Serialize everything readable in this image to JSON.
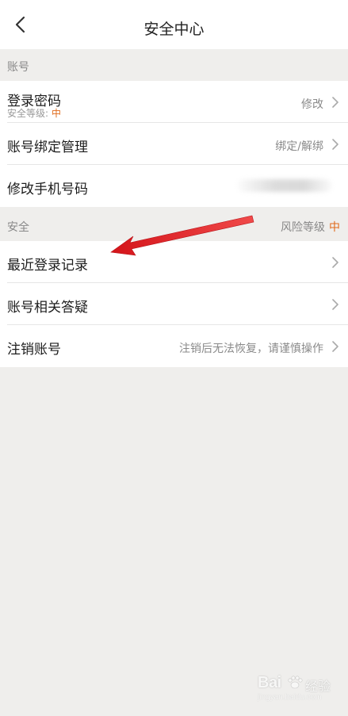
{
  "nav": {
    "title": "安全中心",
    "back_icon": "chevron-left-icon"
  },
  "sections": {
    "account": {
      "header": "账号",
      "rows": [
        {
          "label": "登录密码",
          "sublabel": "安全等级:",
          "sublevel": "中",
          "value": "修改"
        },
        {
          "label": "账号绑定管理",
          "value": "绑定/解绑"
        },
        {
          "label": "修改手机号码",
          "value_blurred": true
        }
      ]
    },
    "security": {
      "header": "安全",
      "risk_label": "风险等级",
      "risk_level": "中",
      "rows": [
        {
          "label": "最近登录记录",
          "value": ""
        },
        {
          "label": "账号相关答疑",
          "value": ""
        },
        {
          "label": "注销账号",
          "value": "注销后无法恢复，请谨慎操作"
        }
      ]
    }
  },
  "colors": {
    "background": "#efeeec",
    "accent_orange": "#e06b1c",
    "annotation_red": "#e0191c"
  },
  "watermark": {
    "brand": "Bai",
    "text": "经验",
    "url": "jingyan.baidu.com"
  }
}
